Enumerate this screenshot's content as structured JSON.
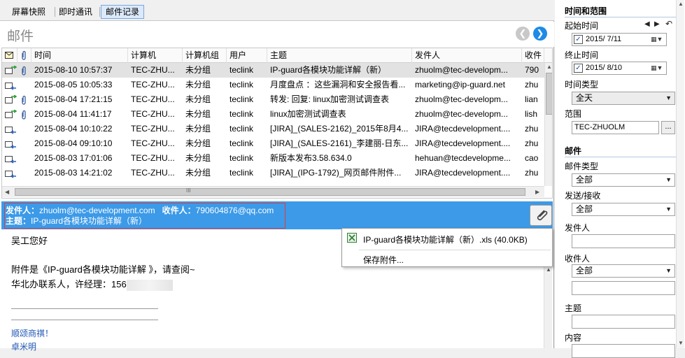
{
  "tabs": [
    {
      "label": "屏幕快照",
      "active": false
    },
    {
      "label": "即时通讯",
      "active": false
    },
    {
      "label": "邮件记录",
      "active": true
    }
  ],
  "page_title": "邮件",
  "columns": [
    "时间",
    "计算机",
    "计算机组",
    "用户",
    "主题",
    "发件人",
    "收件"
  ],
  "rows": [
    {
      "time": "2015-08-10 10:57:37",
      "computer": "TEC-ZHU...",
      "group": "未分组",
      "user": "teclink",
      "subject": "IP-guard各模块功能详解（新）",
      "sender": "zhuolm@tec-developm...",
      "recipient": "790",
      "direction": "out",
      "attach": true,
      "selected": true
    },
    {
      "time": "2015-08-05 10:05:33",
      "computer": "TEC-ZHU...",
      "group": "未分组",
      "user": "teclink",
      "subject": "月度盘点 ：这些漏洞和安全报告看...",
      "sender": "marketing@ip-guard.net",
      "recipient": "zhu",
      "direction": "in",
      "attach": false,
      "selected": false
    },
    {
      "time": "2015-08-04 17:21:15",
      "computer": "TEC-ZHU...",
      "group": "未分组",
      "user": "teclink",
      "subject": "转发: 回复: linux加密测试调查表",
      "sender": "zhuolm@tec-developm...",
      "recipient": "lian",
      "direction": "out",
      "attach": true,
      "selected": false
    },
    {
      "time": "2015-08-04 11:41:17",
      "computer": "TEC-ZHU...",
      "group": "未分组",
      "user": "teclink",
      "subject": "linux加密测试调查表",
      "sender": "zhuolm@tec-developm...",
      "recipient": "lish",
      "direction": "out",
      "attach": true,
      "selected": false
    },
    {
      "time": "2015-08-04 10:10:22",
      "computer": "TEC-ZHU...",
      "group": "未分组",
      "user": "teclink",
      "subject": "[JIRA]_(SALES-2162)_2015年8月4...",
      "sender": "JIRA@tecdevelopment....",
      "recipient": "zhu",
      "direction": "in",
      "attach": false,
      "selected": false
    },
    {
      "time": "2015-08-04 09:10:10",
      "computer": "TEC-ZHU...",
      "group": "未分组",
      "user": "teclink",
      "subject": "[JIRA]_(SALES-2161)_李建丽-日东...",
      "sender": "JIRA@tecdevelopment....",
      "recipient": "zhu",
      "direction": "in",
      "attach": false,
      "selected": false
    },
    {
      "time": "2015-08-03 17:01:06",
      "computer": "TEC-ZHU...",
      "group": "未分组",
      "user": "teclink",
      "subject": "新版本发布3.58.634.0",
      "sender": "hehuan@tecdevelopme...",
      "recipient": "cao",
      "direction": "in",
      "attach": false,
      "selected": false
    },
    {
      "time": "2015-08-03 14:21:02",
      "computer": "TEC-ZHU...",
      "group": "未分组",
      "user": "teclink",
      "subject": "[JIRA]_(IPG-1792)_网页邮件附件...",
      "sender": "JIRA@tecdevelopment....",
      "recipient": "zhu",
      "direction": "in",
      "attach": false,
      "selected": false
    }
  ],
  "hscroll_thumb_glyph": "III",
  "mail": {
    "sender_label": "发件人：",
    "sender": "zhuolm@tec-development.com",
    "recipient_label": "收件人：",
    "recipient": "790604876@qq.com",
    "subject_label": "主题：",
    "subject": "IP-guard各模块功能详解（新）",
    "body": {
      "greeting": "吴工您好",
      "line1": "附件是《IP-guard各模块功能详解 》，请查阅~",
      "line2_prefix": "华北办联系人，许经理：156",
      "closing": "顺颂商祺！",
      "signature": "卓米明"
    }
  },
  "attachment_menu": {
    "file": "IP-guard各模块功能详解（新）.xls (40.0KB)",
    "save": "保存附件..."
  },
  "side": {
    "section_time": "时间和范围",
    "start_label": "起始时间",
    "start_value": "2015/  7/11",
    "end_label": "终止时间",
    "end_value": "2015/  8/10",
    "time_type_label": "时间类型",
    "time_type_value": "全天",
    "range_label": "范围",
    "range_value": "TEC-ZHUOLM",
    "range_button": "...",
    "section_mail": "邮件",
    "mail_type_label": "邮件类型",
    "mail_type_value": "全部",
    "send_recv_label": "发送/接收",
    "send_recv_value": "全部",
    "sender_label": "发件人",
    "recipient_label": "收件人",
    "recipient_value": "全部",
    "subject_label": "主题",
    "content_label": "内容"
  },
  "colors": {
    "accent": "#3c9ae8",
    "nav_next": "#1e8ae6",
    "highlight_border": "#e23b3b",
    "selected_row": "#e2e2e2"
  }
}
